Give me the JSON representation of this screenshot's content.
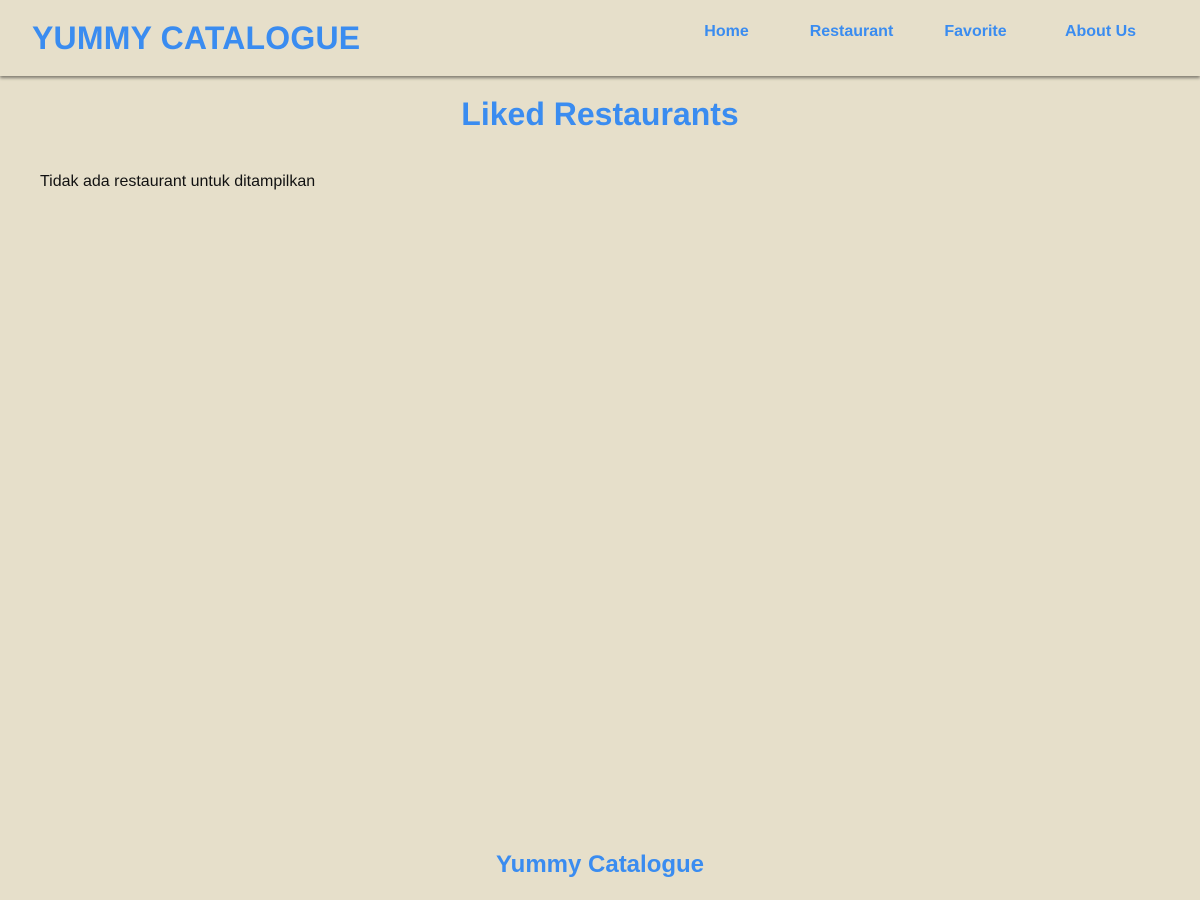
{
  "colors": {
    "background": "#e6dfca",
    "accent": "#3a8cf0",
    "text": "#111111"
  },
  "header": {
    "brand": "YUMMY CATALOGUE",
    "nav": [
      {
        "label": "Home"
      },
      {
        "label": "Restaurant"
      },
      {
        "label": "Favorite"
      },
      {
        "label": "About Us"
      }
    ]
  },
  "main": {
    "title": "Liked Restaurants",
    "empty_message": "Tidak ada restaurant untuk ditampilkan"
  },
  "footer": {
    "text": "Yummy Catalogue"
  }
}
